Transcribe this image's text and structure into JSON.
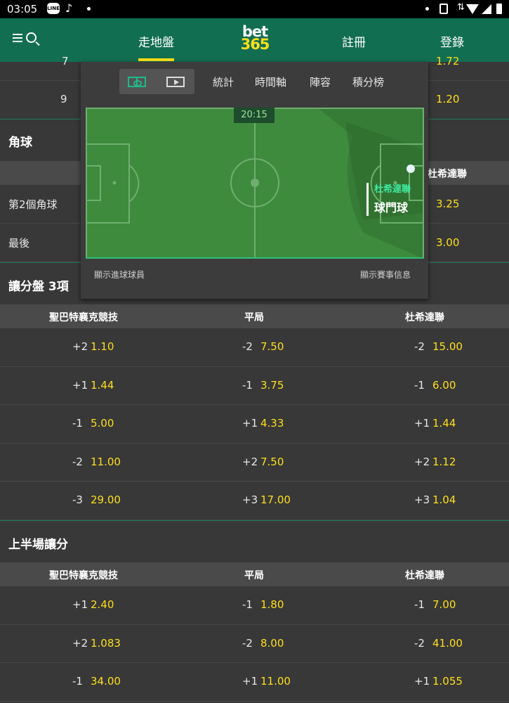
{
  "status_bar": {
    "time": "03:05",
    "line_label": "LINE"
  },
  "header": {
    "nav": [
      "走地盤",
      "註冊",
      "登錄"
    ],
    "logo_top": "bet",
    "logo_bottom": "365"
  },
  "top_rows": [
    {
      "label": "7",
      "odds": "1.72"
    },
    {
      "label": "9",
      "odds": "1.20"
    }
  ],
  "corners": {
    "title": "角球",
    "away_header": "杜希達聯",
    "rows": [
      {
        "label": "第2個角球",
        "odds": "3.25"
      },
      {
        "label": "最後",
        "odds": "3.00"
      }
    ]
  },
  "handicap": {
    "title": "讓分盤 3項",
    "headers": [
      "聖巴特襄克競技",
      "平局",
      "杜希達聯"
    ],
    "rows": [
      [
        [
          "+2",
          "1.10"
        ],
        [
          "-2",
          "7.50"
        ],
        [
          "-2",
          "15.00"
        ]
      ],
      [
        [
          "+1",
          "1.44"
        ],
        [
          "-1",
          "3.75"
        ],
        [
          "-1",
          "6.00"
        ]
      ],
      [
        [
          "-1",
          "5.00"
        ],
        [
          "+1",
          "4.33"
        ],
        [
          "+1",
          "1.44"
        ]
      ],
      [
        [
          "-2",
          "11.00"
        ],
        [
          "+2",
          "7.50"
        ],
        [
          "+2",
          "1.12"
        ]
      ],
      [
        [
          "-3",
          "29.00"
        ],
        [
          "+3",
          "17.00"
        ],
        [
          "+3",
          "1.04"
        ]
      ]
    ]
  },
  "first_half": {
    "title": "上半場讓分",
    "headers": [
      "聖巴特襄克競技",
      "平局",
      "杜希達聯"
    ],
    "rows": [
      [
        [
          "+1",
          "2.40"
        ],
        [
          "-1",
          "1.80"
        ],
        [
          "-1",
          "7.00"
        ]
      ],
      [
        [
          "+2",
          "1.083"
        ],
        [
          "-2",
          "8.00"
        ],
        [
          "-2",
          "41.00"
        ]
      ],
      [
        [
          "-1",
          "34.00"
        ],
        [
          "+1",
          "11.00"
        ],
        [
          "+1",
          "1.055"
        ]
      ]
    ]
  },
  "overlay": {
    "tabs": [
      "統計",
      "時間軸",
      "陣容",
      "積分榜"
    ],
    "clock": "20:15",
    "event_team": "杜希達聯",
    "event_name": "球門球",
    "footer_left": "顯示進球球員",
    "footer_right": "顯示賽事信息"
  }
}
